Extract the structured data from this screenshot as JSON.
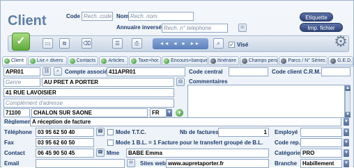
{
  "header": {
    "title": "Client",
    "code_label": "Code",
    "code_placeholder": "Rech. code",
    "nom_label": "Nom",
    "nom_placeholder": "Rech. nom",
    "annuaire_label": "Annuaire inversé",
    "annuaire_placeholder": "Rech. n° telephone",
    "etiquette_button": "Etiquette",
    "imp_fichier_button": "Imp. fichier",
    "vise_label": "Visé"
  },
  "tabs": [
    {
      "label": "Client"
    },
    {
      "label": "Livr.+ divers"
    },
    {
      "label": "Contacts"
    },
    {
      "label": "Articles"
    },
    {
      "label": "Taxe+hor."
    },
    {
      "label": "Encours+banque"
    },
    {
      "label": "Itinéraire"
    },
    {
      "label": "Champs perso"
    },
    {
      "label": "Parcs / N° Séries"
    },
    {
      "label": "G.E.D."
    }
  ],
  "form": {
    "code": "APR01",
    "compte_associe_label": "Compte associé",
    "compte_associe": "411APR01",
    "code_central_label": "Code central",
    "code_client_crm_label": "Code client C.R.M.",
    "genre_placeholder": "Genre",
    "raison_sociale": "AU PRET A PORTER",
    "commentaires_label": "Commentaires",
    "adresse": "41 RUE LAVOISIER",
    "complement_placeholder": "Complément d'adresse",
    "code_postal": "71100",
    "ville": "CHALON SUR SAONE",
    "pays": "FR",
    "reglement_label": "Règlement",
    "reglement": "A réception de facture",
    "telephone_label": "Téléphone",
    "telephone": "03 95 62 50 40",
    "mode_ttc_label": "Mode T.T.C.",
    "nb_factures_label": "Nb de factures",
    "nb_factures": "1",
    "employe_label": "Employé",
    "fax_label": "Fax",
    "fax": "03 95 62 60 50",
    "mode_bl_label": "Mode 1 B.L. = 1 Facture pour le transfert groupé de B.L.",
    "code_rep_label": "Code rep.",
    "contact_label": "Contact",
    "contact_tel": "06 45 90 50 45",
    "civilite": "Mme",
    "contact_nom": "BABE Emma",
    "categorie_label": "Catégorie",
    "categorie": "PRO",
    "email_label": "Email",
    "site_web_label": "Sites web",
    "site_web": "www.aupretaporter.fr",
    "branche_label": "Branche",
    "branche": "Habillement"
  }
}
